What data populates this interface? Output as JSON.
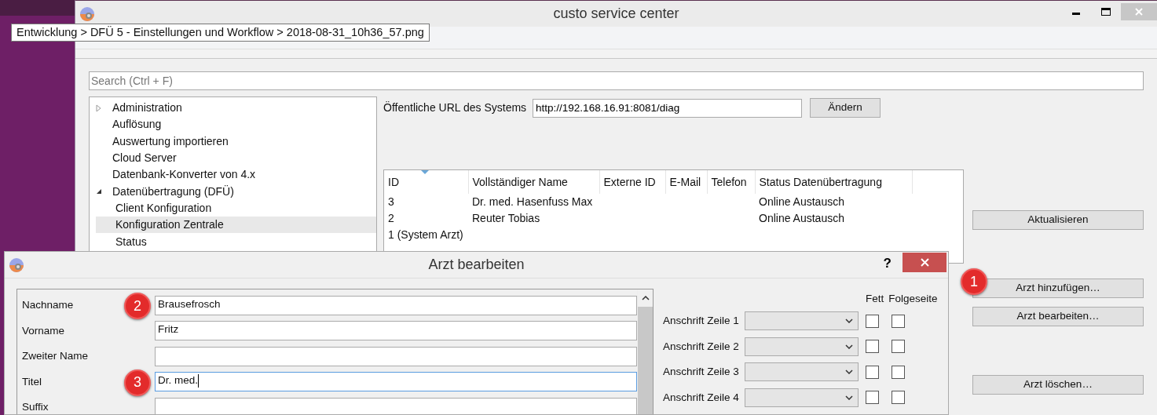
{
  "main_window": {
    "title": "custo service center",
    "search": {
      "placeholder": "Search (Ctrl + F)"
    },
    "tree": [
      {
        "label": "Administration",
        "expanded": false,
        "selected": false
      },
      {
        "label": "Auflösung",
        "selected": false
      },
      {
        "label": "Auswertung importieren",
        "selected": false
      },
      {
        "label": "Cloud Server",
        "selected": false
      },
      {
        "label": "Datenbank-Konverter von 4.x",
        "selected": false
      },
      {
        "label": "Datenübertragung (DFÜ)",
        "expanded": true,
        "selected": false,
        "children": [
          {
            "label": "Client Konfiguration",
            "selected": false
          },
          {
            "label": "Konfiguration Zentrale",
            "selected": true
          },
          {
            "label": "Status",
            "selected": false
          }
        ]
      }
    ],
    "url_label": "Öffentliche URL des Systems",
    "url_value": "http://192.168.16.91:8081/diag",
    "change_button": "Ändern",
    "table": {
      "columns": [
        {
          "label": "ID",
          "sorted": true
        },
        {
          "label": "Vollständiger Name",
          "sorted": false
        },
        {
          "label": "Externe ID",
          "sorted": false
        },
        {
          "label": "E-Mail",
          "sorted": false
        },
        {
          "label": "Telefon",
          "sorted": false
        },
        {
          "label": "Status Datenübertragung",
          "sorted": false
        }
      ],
      "rows": [
        {
          "id": "3",
          "full_name": "Dr. med. Hasenfuss Max",
          "status": "Online Austausch"
        },
        {
          "id": "2",
          "full_name": "Reuter Tobias",
          "status": "Online Austausch"
        },
        {
          "id": "1 (System Arzt)"
        }
      ]
    },
    "buttons": [
      {
        "label": "Aktualisieren"
      },
      {
        "label": "Arzt hinzufügen…",
        "marker": "1"
      },
      {
        "label": "Arzt bearbeiten…"
      },
      {
        "label": "Arzt löschen…"
      }
    ]
  },
  "tooltip": {
    "text": "Entwicklung > DFÜ 5 - Einstellungen und Workflow > 2018-08-31_10h36_57.png"
  },
  "dialog": {
    "title": "Arzt bearbeiten",
    "help": "?",
    "fields": [
      {
        "label": "Nachname",
        "value": "Brausefrosch",
        "focused": false,
        "marker": "2"
      },
      {
        "label": "Vorname",
        "value": "Fritz",
        "focused": false
      },
      {
        "label": "Zweiter Name",
        "focused": false
      },
      {
        "label": "Titel",
        "value": "Dr. med.",
        "focused": true,
        "marker": "3"
      },
      {
        "label": "Suffix",
        "focused": false
      }
    ],
    "address_headers": [
      "Fett",
      "Folgeseite"
    ],
    "address_rows": [
      {
        "label": "Anschrift Zeile 1",
        "bold": false,
        "next_page": false
      },
      {
        "label": "Anschrift Zeile 2",
        "bold": false,
        "next_page": false
      },
      {
        "label": "Anschrift Zeile 3",
        "bold": false,
        "next_page": false
      },
      {
        "label": "Anschrift Zeile 4",
        "bold": false,
        "next_page": false
      }
    ]
  }
}
